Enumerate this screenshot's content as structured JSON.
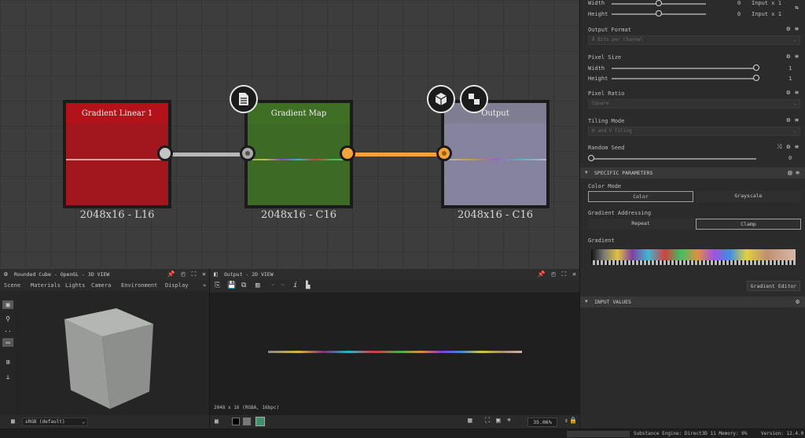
{
  "graph": {
    "nodes": [
      {
        "title": "Gradient Linear 1",
        "resolution": "2048x16 - L16",
        "color": "#a1171d",
        "head": "#b3121b",
        "line": "#e0a0a0"
      },
      {
        "title": "Gradient Map",
        "resolution": "2048x16 - C16",
        "color": "#3d6a25",
        "head": "#3f6e25",
        "line": "#8fb07a"
      },
      {
        "title": "Output",
        "resolution": "2048x16 - C16",
        "color": "#86839e",
        "head": "#7f7d91",
        "line": "#b8b8c8"
      }
    ],
    "wire_colors": {
      "grey": "#b9b9b9",
      "orange": "#f4a43a"
    }
  },
  "properties": {
    "rows_top": [
      {
        "label": "Width",
        "value": "0",
        "extra": "Input x 1"
      },
      {
        "label": "Height",
        "value": "0",
        "extra": "Input x 1"
      }
    ],
    "output_format": {
      "label": "Output Format",
      "value": "8 Bits per Channel"
    },
    "pixel_size": {
      "label": "Pixel Size",
      "width_label": "Width",
      "width_value": "1",
      "height_label": "Height",
      "height_value": "1"
    },
    "pixel_ratio": {
      "label": "Pixel Ratio",
      "value": "Square"
    },
    "tiling_mode": {
      "label": "Tiling Mode",
      "value": "H and V Tiling"
    },
    "random_seed": {
      "label": "Random Seed",
      "value": "0"
    },
    "specific_section": "SPECIFIC PARAMETERS",
    "color_mode": {
      "label": "Color Mode",
      "options": [
        "Color",
        "Grayscale"
      ],
      "selected": "Color"
    },
    "gradient_addressing": {
      "label": "Gradient Addressing",
      "options": [
        "Repeat",
        "Clamp"
      ],
      "selected": "Clamp"
    },
    "gradient": {
      "label": "Gradient",
      "editor_button": "Gradient Editor"
    },
    "input_values_section": "INPUT VALUES"
  },
  "view3d": {
    "title": "Rounded Cube - OpenGL - 3D VIEW",
    "menu": [
      "Scene",
      "Materials",
      "Lights",
      "Camera",
      "Environment",
      "Display"
    ],
    "colorspace": "sRGB (default)"
  },
  "view2d": {
    "title": "Output - 2D VIEW",
    "info": "2048 x 16 (RGBA, 16bpc)",
    "zoom": "35.06%"
  },
  "status": {
    "engine": "Substance Engine: Direct3D 11 Memory: 0%",
    "version": "Version: 12.4.0"
  }
}
